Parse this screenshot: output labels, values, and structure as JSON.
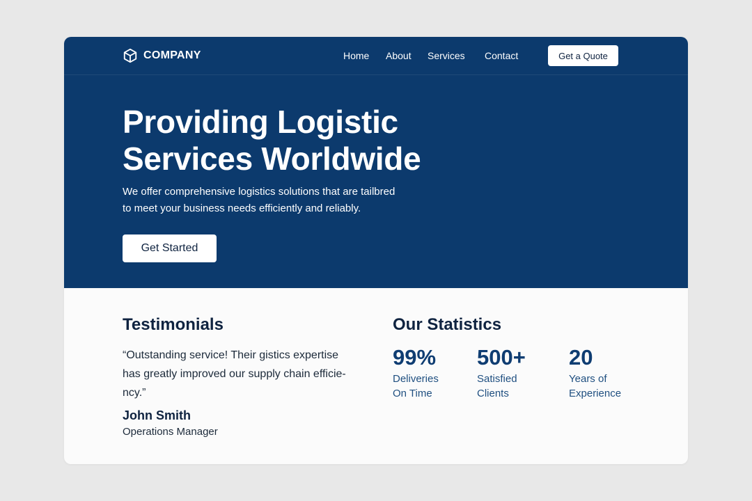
{
  "brand": {
    "name": "COMPANY",
    "icon": "cube-icon",
    "hero_color": "#0c3a6d",
    "text_dark": "#0f2340",
    "stat_color": "#0f3d72"
  },
  "nav": {
    "links": [
      "Home",
      "About",
      "Services",
      "Contact"
    ],
    "cta_label": "Get a Quote"
  },
  "hero": {
    "title_lines": [
      "Providing Logistic",
      "Services Worldwide"
    ],
    "subtitle_lines": [
      "We offer comprehensive logistics solutions that are tailbred",
      "to meet your business needs efficiently and reliably."
    ],
    "cta_label": "Get Started"
  },
  "testimonials": {
    "title": "Testimonials",
    "quote_lines": [
      "“Outstanding service!  Their gistics expertise",
      "has greatly improved our supply chain efficie-",
      "ncy.”"
    ],
    "author": "John Smith",
    "role": "Operations Manager"
  },
  "statistics": {
    "title": "Our Statistics",
    "items": [
      {
        "value": "99%",
        "label_lines": [
          "Deliveries",
          "On Time"
        ]
      },
      {
        "value": "500+",
        "label_lines": [
          "Satisfied",
          "Clients"
        ]
      },
      {
        "value": "20",
        "label_lines": [
          "Years of",
          "Experience"
        ]
      }
    ]
  }
}
